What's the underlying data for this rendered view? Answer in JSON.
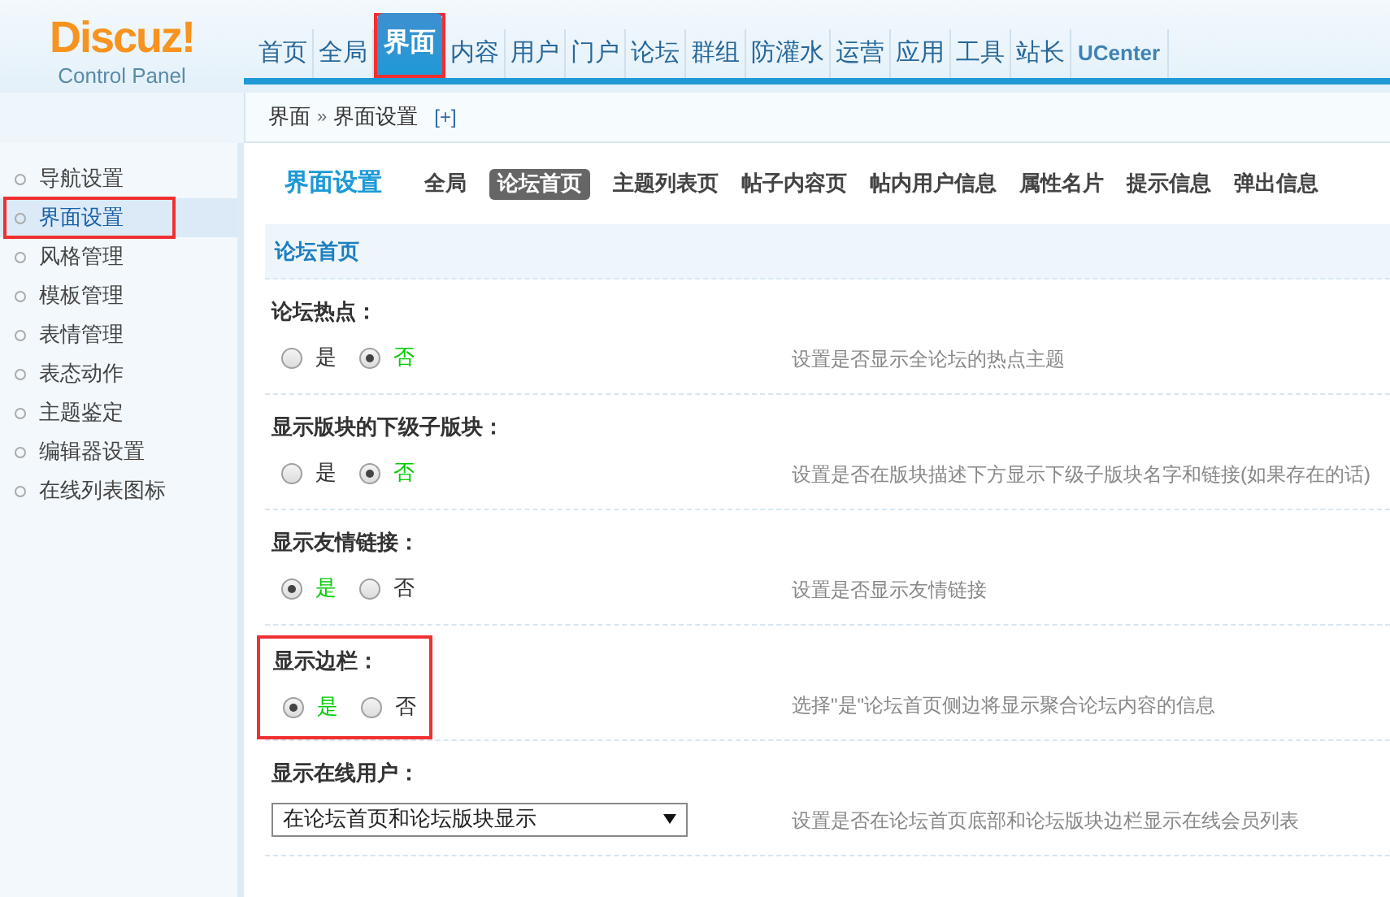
{
  "logo": {
    "title": "Discuz!",
    "subtitle": "Control Panel"
  },
  "nav": [
    {
      "label": "首页",
      "selected": false,
      "highlighted": false
    },
    {
      "label": "全局",
      "selected": false,
      "highlighted": false
    },
    {
      "label": "界面",
      "selected": true,
      "highlighted": true
    },
    {
      "label": "内容",
      "selected": false,
      "highlighted": false
    },
    {
      "label": "用户",
      "selected": false,
      "highlighted": false
    },
    {
      "label": "门户",
      "selected": false,
      "highlighted": false
    },
    {
      "label": "论坛",
      "selected": false,
      "highlighted": false
    },
    {
      "label": "群组",
      "selected": false,
      "highlighted": false
    },
    {
      "label": "防灌水",
      "selected": false,
      "highlighted": false
    },
    {
      "label": "运营",
      "selected": false,
      "highlighted": false
    },
    {
      "label": "应用",
      "selected": false,
      "highlighted": false
    },
    {
      "label": "工具",
      "selected": false,
      "highlighted": false
    },
    {
      "label": "站长",
      "selected": false,
      "highlighted": false
    },
    {
      "label": "UCenter",
      "selected": false,
      "highlighted": false
    }
  ],
  "breadcrumb": {
    "path": [
      "界面",
      "界面设置"
    ],
    "separator": "»",
    "toggle": "[+]"
  },
  "sidebar": [
    {
      "label": "导航设置",
      "selected": false,
      "highlighted": false
    },
    {
      "label": "界面设置",
      "selected": true,
      "highlighted": true
    },
    {
      "label": "风格管理",
      "selected": false,
      "highlighted": false
    },
    {
      "label": "模板管理",
      "selected": false,
      "highlighted": false
    },
    {
      "label": "表情管理",
      "selected": false,
      "highlighted": false
    },
    {
      "label": "表态动作",
      "selected": false,
      "highlighted": false
    },
    {
      "label": "主题鉴定",
      "selected": false,
      "highlighted": false
    },
    {
      "label": "编辑器设置",
      "selected": false,
      "highlighted": false
    },
    {
      "label": "在线列表图标",
      "selected": false,
      "highlighted": false
    }
  ],
  "page": {
    "title": "界面设置",
    "tabs": [
      {
        "label": "全局",
        "selected": false
      },
      {
        "label": "论坛首页",
        "selected": true
      },
      {
        "label": "主题列表页",
        "selected": false
      },
      {
        "label": "帖子内容页",
        "selected": false
      },
      {
        "label": "帖内用户信息",
        "selected": false
      },
      {
        "label": "属性名片",
        "selected": false
      },
      {
        "label": "提示信息",
        "selected": false
      },
      {
        "label": "弹出信息",
        "selected": false
      }
    ]
  },
  "section": {
    "title": "论坛首页",
    "settings": [
      {
        "kind": "radio",
        "label": "论坛热点：",
        "highlighted": false,
        "options": [
          {
            "label": "是",
            "selected": false
          },
          {
            "label": "否",
            "selected": true
          }
        ],
        "description": "设置是否显示全论坛的热点主题"
      },
      {
        "kind": "radio",
        "label": "显示版块的下级子版块：",
        "highlighted": false,
        "options": [
          {
            "label": "是",
            "selected": false
          },
          {
            "label": "否",
            "selected": true
          }
        ],
        "description": "设置是否在版块描述下方显示下级子版块名字和链接(如果存在的话)"
      },
      {
        "kind": "radio",
        "label": "显示友情链接：",
        "highlighted": false,
        "options": [
          {
            "label": "是",
            "selected": true
          },
          {
            "label": "否",
            "selected": false
          }
        ],
        "description": "设置是否显示友情链接"
      },
      {
        "kind": "radio",
        "label": "显示边栏：",
        "highlighted": true,
        "options": [
          {
            "label": "是",
            "selected": true
          },
          {
            "label": "否",
            "selected": false
          }
        ],
        "description": "选择\"是\"论坛首页侧边将显示聚合论坛内容的信息"
      },
      {
        "kind": "select",
        "label": "显示在线用户：",
        "highlighted": false,
        "value": "在论坛首页和论坛版块显示",
        "description": "设置是否在论坛首页底部和论坛版块边栏显示在线会员列表"
      }
    ]
  }
}
